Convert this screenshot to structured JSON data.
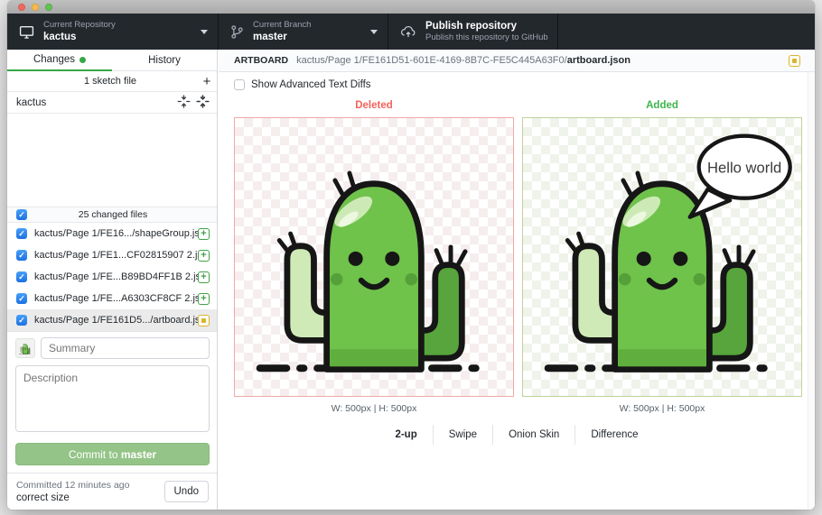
{
  "toolbar": {
    "repository": {
      "label": "Current Repository",
      "value": "kactus"
    },
    "branch": {
      "label": "Current Branch",
      "value": "master"
    },
    "publish": {
      "title": "Publish repository",
      "subtitle": "Publish this repository to GitHub"
    }
  },
  "sidebar": {
    "tabs": {
      "changes": "Changes",
      "history": "History"
    },
    "sketch_files_header": "1 sketch file",
    "sketch_file_name": "kactus",
    "changed_files_header": "25 changed files",
    "files": [
      {
        "path": "kactus/Page 1/FE16.../shapeGroup.json",
        "status": "added"
      },
      {
        "path": "kactus/Page 1/FE1...CF02815907 2.json",
        "status": "added"
      },
      {
        "path": "kactus/Page 1/FE...B89BD4FF1B 2.json",
        "status": "added"
      },
      {
        "path": "kactus/Page 1/FE...A6303CF8CF 2.json",
        "status": "added"
      },
      {
        "path": "kactus/Page 1/FE161D5.../artboard.json",
        "status": "modified"
      }
    ],
    "commit": {
      "summary_placeholder": "Summary",
      "description_placeholder": "Description",
      "button_prefix": "Commit to ",
      "button_branch": "master"
    },
    "undo_section": {
      "line1": "Committed 12 minutes ago",
      "line2": "correct size",
      "undo_label": "Undo"
    }
  },
  "main": {
    "breadcrumb": {
      "kind": "ARTBOARD",
      "path": "kactus/Page 1/FE161D51-601E-4169-8B7C-FE5C445A63F0/",
      "file": "artboard.json"
    },
    "advanced_diffs_label": "Show Advanced Text Diffs",
    "diff": {
      "left_label": "Deleted",
      "right_label": "Added",
      "left_size": "W: 500px | H: 500px",
      "right_size": "W: 500px | H: 500px",
      "bubble_text": "Hello world",
      "modes": [
        "2-up",
        "Swipe",
        "Onion Skin",
        "Difference"
      ],
      "active_mode": "2-up"
    }
  },
  "colors": {
    "accent_green": "#36a746",
    "deleted_red": "#f2635c",
    "added_green": "#3db54a",
    "commit_button_green": "#94c487",
    "checkbox_blue": "#2f7de1",
    "modified_yellow": "#d9b430",
    "toolbar_dark": "#23282d",
    "cactus_body_green": "#6fc24a"
  }
}
